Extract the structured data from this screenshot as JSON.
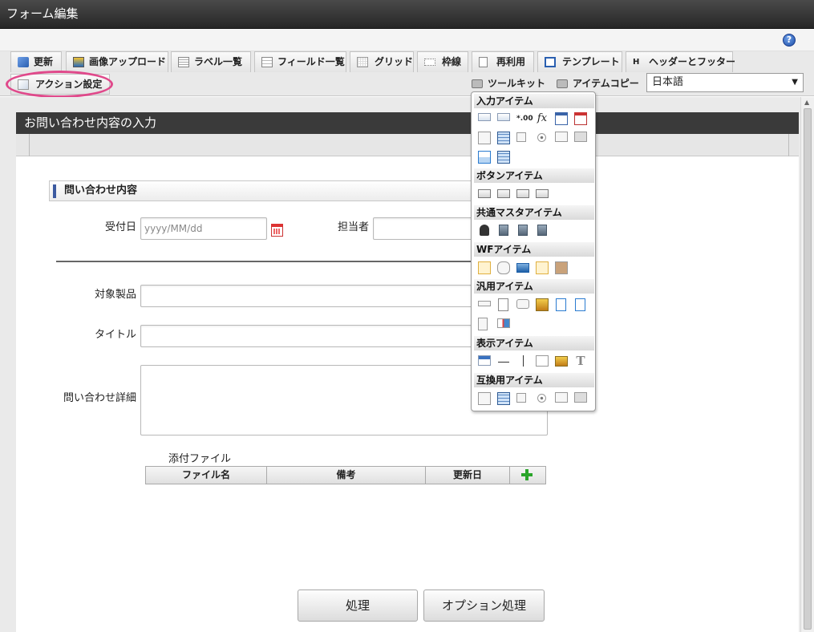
{
  "window": {
    "title": "フォーム編集"
  },
  "toolbar": {
    "tabs": [
      {
        "label": "更新",
        "icon": "update-icon"
      },
      {
        "label": "画像アップロード",
        "icon": "image-upload-icon"
      },
      {
        "label": "ラベル一覧",
        "icon": "label-list-icon"
      },
      {
        "label": "フィールド一覧",
        "icon": "field-list-icon"
      },
      {
        "label": "グリッド",
        "icon": "grid-icon"
      },
      {
        "label": "枠線",
        "icon": "border-icon"
      },
      {
        "label": "再利用",
        "icon": "reuse-icon"
      },
      {
        "label": "テンプレート",
        "icon": "template-icon"
      },
      {
        "label": "ヘッダーとフッター",
        "icon": "header-footer-icon"
      }
    ],
    "action_settings": "アクション設定",
    "toolkit": "ツールキット",
    "item_copy": "アイテムコピー",
    "language": "日本語"
  },
  "form": {
    "title": "お問い合わせ内容の入力",
    "section_title": "問い合わせ内容",
    "fields": {
      "received_date_label": "受付日",
      "received_date_placeholder": "yyyy/MM/dd",
      "assignee_label": "担当者",
      "product_label": "対象製品",
      "title_label": "タイトル",
      "detail_label": "問い合わせ詳細"
    },
    "attachments": {
      "label": "添付ファイル",
      "columns": [
        "ファイル名",
        "備考",
        "更新日"
      ]
    },
    "buttons": {
      "process": "処理",
      "option_process": "オプション処理"
    }
  },
  "palette": {
    "categories": [
      "入力アイテム",
      "ボタンアイテム",
      "共通マスタアイテム",
      "WFアイテム",
      "汎用アイテム",
      "表示アイテム",
      "互換用アイテム"
    ],
    "number_glyph": "*.00",
    "fx_glyph": "fx",
    "text_glyph": "T"
  },
  "colors": {
    "highlight": "#e0498b",
    "header": "#3a3a3a",
    "section_accent": "#3c5aa0",
    "add_button": "#2aa52a"
  }
}
